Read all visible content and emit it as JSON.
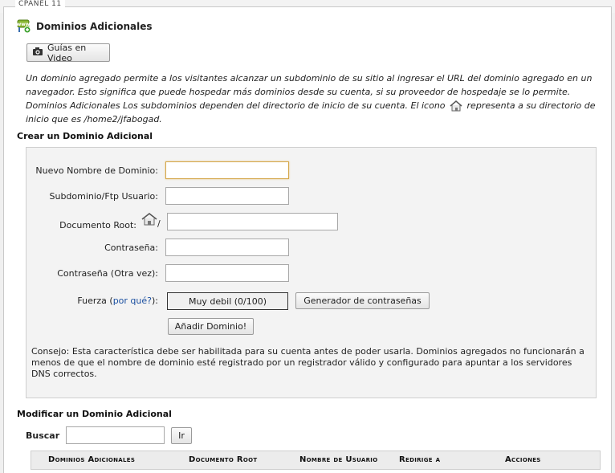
{
  "panel_legend": "CPANEL 11",
  "page": {
    "title": "Dominios Adicionales",
    "video_button": "Guías en Video",
    "intro_part1": "Un dominio agregado permite a los visitantes alcanzar un subdominio de su sitio al ingresar el URL del dominio agregado en un navegador. Esto significa que puede hospedar más dominios desde su cuenta, si su proveedor de hospedaje se lo permite. Dominios Adicionales Los subdominios dependen del directorio de inicio de su cuenta. El icono",
    "intro_part2": "representa a su directorio de inicio que es /home2/jfabogad."
  },
  "create": {
    "heading": "Crear un Dominio Adicional",
    "new_domain_label": "Nuevo Nombre de Dominio:",
    "new_domain_value": "",
    "subdomain_label": "Subdominio/Ftp Usuario:",
    "subdomain_value": "",
    "docroot_label": "Documento Root:",
    "docroot_slash": "/",
    "docroot_value": "",
    "password_label": "Contraseña:",
    "password_value": "",
    "password2_label": "Contraseña (Otra vez):",
    "password2_value": "",
    "strength_label": "Fuerza",
    "strength_open": "(",
    "strength_link": "por qué?",
    "strength_close": "):",
    "strength_value": "Muy debil (0/100)",
    "generator_button": "Generador de contraseñas",
    "add_button": "Añadir Dominio!",
    "tip": "Consejo: Esta característica debe ser habilitada para su cuenta antes de poder usarla. Dominios agregados no funcionarán a menos de que el nombre de dominio esté registrado por un registrador válido y configurado para apuntar a los servidores DNS correctos."
  },
  "modify": {
    "heading": "Modificar un Dominio Adicional",
    "search_label": "Buscar",
    "search_value": "",
    "go_button": "Ir",
    "columns": [
      "Dominios Adicionales",
      "Documento Root",
      "Nombre de Usuario",
      "Redirige a",
      "Acciones"
    ]
  },
  "icons": {
    "page_icon": "addon-domains-icon",
    "camera": "camera-icon",
    "home": "home-icon"
  }
}
